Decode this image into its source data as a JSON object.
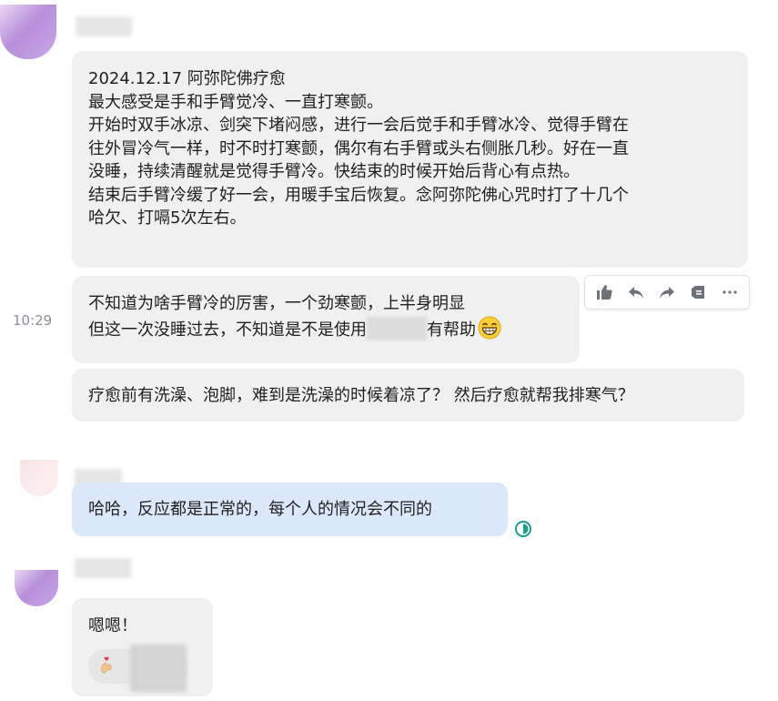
{
  "time_label": "10:29",
  "colors": {
    "bubble_gray": "#f0f0f0",
    "bubble_blue": "#dbe8fb",
    "toolbar_icon": "#6d7278",
    "status_teal": "#1aa08a"
  },
  "messages": [
    {
      "lines": [
        "2024.12.17 阿弥陀佛疗愈",
        "最大感受是手和手臂觉冷、一直打寒颤。",
        "开始时双手冰凉、剑突下堵闷感，进行一会后觉手和手臂冰冷、觉得手臂在",
        "往外冒冷气一样，时不时打寒颤，偶尔有右手臂或头右侧胀几秒。好在一直",
        "没睡，持续清醒就是觉得手臂冷。快结束的时候开始后背心有点热。",
        "结束后手臂冷缓了好一会，用暖手宝后恢复。念阿弥陀佛心咒时打了十几个",
        "哈欠、打嗝5次左右。"
      ]
    },
    {
      "line1": "不知道为啥手臂冷的厉害，一个劲寒颤，上半身明显",
      "line2_before": "但这一次没睡过去，不知道是不是使用",
      "line2_after": "有帮助",
      "emoji": "grinning-face-icon"
    },
    {
      "text": "疗愈前有洗澡、泡脚，难到是洗澡的时候着凉了？ 然后疗愈就帮我排寒气？"
    },
    {
      "text": "哈哈，反应都是正常的，每个人的情况会不同的"
    },
    {
      "text": "嗯嗯！",
      "reaction_icon": "finger-heart-icon"
    }
  ],
  "toolbar": {
    "actions": [
      "thumbs-up-icon",
      "reply-icon",
      "forward-icon",
      "pin-icon",
      "more-icon"
    ]
  }
}
